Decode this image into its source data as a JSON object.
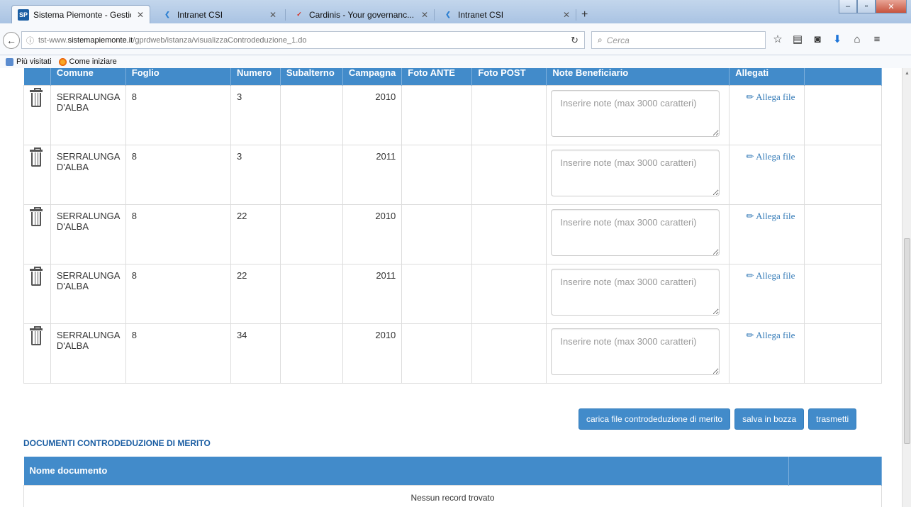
{
  "browser": {
    "tabs": [
      {
        "label": "Sistema Piemonte - Gestio...",
        "favicon": "SP",
        "active": true
      },
      {
        "label": "Intranet CSI",
        "active": false
      },
      {
        "label": "Cardinis - Your governanc...",
        "active": false
      },
      {
        "label": "Intranet CSI",
        "active": false
      }
    ],
    "url_prefix": "tst-www.",
    "url_host": "sistemapiemonte.it",
    "url_path": "/gprdweb/istanza/visualizzaControdeduzione_1.do",
    "search_placeholder": "Cerca",
    "bookmarks": [
      "Più visitati",
      "Come iniziare"
    ]
  },
  "table": {
    "headers": [
      "Comune",
      "Foglio",
      "Numero",
      "Subalterno",
      "Campagna",
      "Foto ANTE",
      "Foto POST",
      "Note Beneficiario",
      "Allegati"
    ],
    "note_placeholder": "Inserire note (max 3000 caratteri)",
    "attach_label": "Allega file",
    "rows": [
      {
        "comune": "SERRALUNGA D'ALBA",
        "foglio": "8",
        "numero": "3",
        "subalterno": "",
        "campagna": "2010"
      },
      {
        "comune": "SERRALUNGA D'ALBA",
        "foglio": "8",
        "numero": "3",
        "subalterno": "",
        "campagna": "2011"
      },
      {
        "comune": "SERRALUNGA D'ALBA",
        "foglio": "8",
        "numero": "22",
        "subalterno": "",
        "campagna": "2010"
      },
      {
        "comune": "SERRALUNGA D'ALBA",
        "foglio": "8",
        "numero": "22",
        "subalterno": "",
        "campagna": "2011"
      },
      {
        "comune": "SERRALUNGA D'ALBA",
        "foglio": "8",
        "numero": "34",
        "subalterno": "",
        "campagna": "2010"
      }
    ]
  },
  "actions": {
    "upload_label": "carica file controdeduzione di merito",
    "draft_label": "salva in bozza",
    "send_label": "trasmetti"
  },
  "documents": {
    "title": "DOCUMENTI CONTRODEDUZIONE DI MERITO",
    "header": "Nome documento",
    "empty_text": "Nessun record trovato"
  },
  "colors": {
    "primary": "#428bca",
    "link": "#337ab7",
    "section_title": "#1b5ea3"
  }
}
